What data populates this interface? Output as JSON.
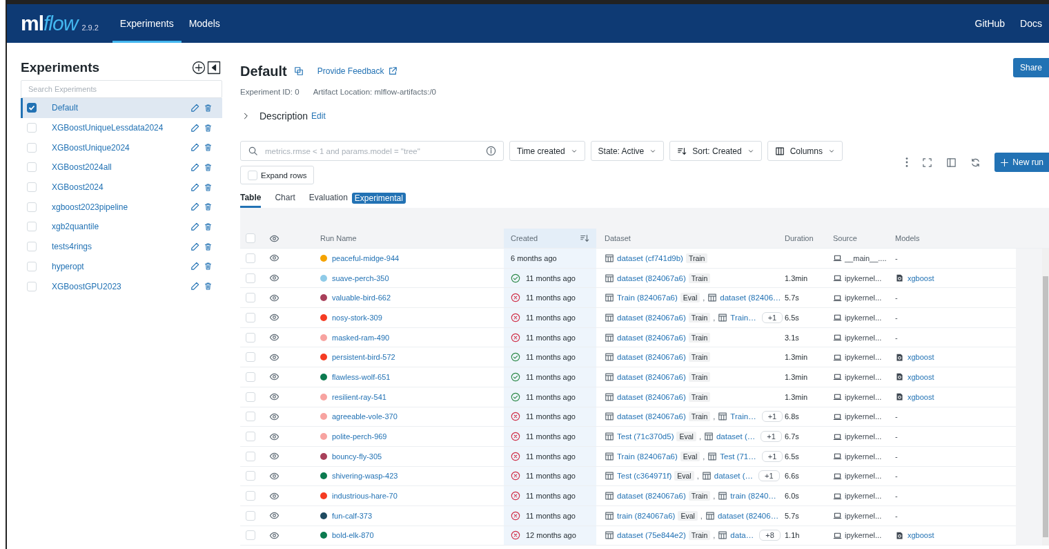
{
  "nav": {
    "logo": {
      "left": "ml",
      "right": "flow"
    },
    "version": "2.9.2",
    "tabs": [
      {
        "label": "Experiments",
        "selected": true
      },
      {
        "label": "Models",
        "selected": false
      }
    ],
    "links": [
      "GitHub",
      "Docs"
    ]
  },
  "sidebar": {
    "title": "Experiments",
    "search": {
      "placeholder": "Search Experiments"
    },
    "items": [
      {
        "name": "Default",
        "selected": true
      },
      {
        "name": "XGBoostUniqueLessdata2024",
        "selected": false
      },
      {
        "name": "XGBoostUnique2024",
        "selected": false
      },
      {
        "name": "XGBoost2024all",
        "selected": false
      },
      {
        "name": "XGBoost2024",
        "selected": false
      },
      {
        "name": "xgboost2023pipeline",
        "selected": false
      },
      {
        "name": "xgb2quantile",
        "selected": false
      },
      {
        "name": "tests4rings",
        "selected": false
      },
      {
        "name": "hyperopt",
        "selected": false
      },
      {
        "name": "XGBoostGPU2023",
        "selected": false
      }
    ]
  },
  "header": {
    "title": "Default",
    "feedback": "Provide Feedback",
    "share": "Share",
    "experiment_id": "Experiment ID: 0",
    "artifact_location": "Artifact Location: mlflow-artifacts:/0",
    "description": "Description",
    "edit": "Edit"
  },
  "toolbar": {
    "search": {
      "placeholder": "metrics.rmse < 1 and params.model = \"tree\""
    },
    "filters": [
      {
        "label": "Time created",
        "kind": "dropdown"
      },
      {
        "label": "State: Active",
        "kind": "dropdown"
      },
      {
        "label": "Sort: Created",
        "kind": "sort"
      },
      {
        "label": "Columns",
        "kind": "columns"
      }
    ],
    "expand_rows": {
      "label": "Expand rows",
      "checked": false
    },
    "new_run": "New run"
  },
  "view_tabs": [
    {
      "label": "Table",
      "selected": true
    },
    {
      "label": "Chart",
      "selected": false
    },
    {
      "label": "Evaluation",
      "selected": false
    }
  ],
  "experimental_badge": "Experimental",
  "table": {
    "select_all": {
      "checked": false
    },
    "columns": [
      "Run Name",
      "Created",
      "Dataset",
      "Duration",
      "Source",
      "Models"
    ],
    "rows": [
      {
        "checked": false,
        "name": "peaceful-midge-944",
        "color": "#f5a300",
        "created": "6 months ago",
        "datasets": [
          {
            "name": "dataset (cf741d9b)",
            "tag": "Train"
          }
        ],
        "source": "__main__....",
        "model": "-",
        "logged_model": false
      },
      {
        "checked": false,
        "name": "suave-perch-350",
        "color": "#8fcbe8",
        "finished": true,
        "created": "11 months ago",
        "datasets": [
          {
            "name": "dataset (824067a6)",
            "tag": "Train"
          }
        ],
        "duration": "1.3min",
        "source": "ipykernel...",
        "model": "xgboost",
        "logged_model": true
      },
      {
        "checked": false,
        "name": "valuable-bird-662",
        "color": "#a8405a",
        "finished": false,
        "created": "11 months ago",
        "datasets": [
          {
            "name": "Train (824067a6)",
            "tag": "Eval"
          },
          {
            "name": "dataset (82406…",
            "separator": ","
          }
        ],
        "duration": "5.7s",
        "source": "ipykernel...",
        "model": "-",
        "logged_model": false
      },
      {
        "checked": false,
        "name": "nosy-stork-309",
        "color": "#f53b22",
        "finished": false,
        "created": "11 months ago",
        "datasets": [
          {
            "name": "dataset (824067a6)",
            "tag": "Train"
          },
          {
            "name": "Train…",
            "separator": ","
          }
        ],
        "more": "+1",
        "duration": "6.5s",
        "source": "ipykernel...",
        "model": "-",
        "logged_model": false
      },
      {
        "checked": false,
        "name": "masked-ram-490",
        "color": "#f7a3a0",
        "finished": false,
        "created": "11 months ago",
        "datasets": [
          {
            "name": "dataset (824067a6)",
            "tag": "Train"
          }
        ],
        "duration": "3.1s",
        "source": "ipykernel...",
        "model": "-",
        "logged_model": false
      },
      {
        "checked": false,
        "name": "persistent-bird-572",
        "color": "#f53b22",
        "finished": true,
        "created": "11 months ago",
        "datasets": [
          {
            "name": "dataset (824067a6)",
            "tag": "Train"
          }
        ],
        "duration": "1.3min",
        "source": "ipykernel...",
        "model": "xgboost",
        "logged_model": true
      },
      {
        "checked": false,
        "name": "flawless-wolf-651",
        "color": "#0b7a4f",
        "finished": true,
        "created": "11 months ago",
        "datasets": [
          {
            "name": "dataset (824067a6)",
            "tag": "Train"
          }
        ],
        "duration": "1.3min",
        "source": "ipykernel...",
        "model": "xgboost",
        "logged_model": true
      },
      {
        "checked": false,
        "name": "resilient-ray-541",
        "color": "#f7a3a0",
        "finished": true,
        "created": "11 months ago",
        "datasets": [
          {
            "name": "dataset (824067a6)",
            "tag": "Train"
          }
        ],
        "duration": "1.3min",
        "source": "ipykernel...",
        "model": "xgboost",
        "logged_model": true
      },
      {
        "checked": false,
        "name": "agreeable-vole-370",
        "color": "#f7a3a0",
        "finished": false,
        "created": "11 months ago",
        "datasets": [
          {
            "name": "dataset (824067a6)",
            "tag": "Train"
          },
          {
            "name": "Train…",
            "separator": ","
          }
        ],
        "more": "+1",
        "duration": "6.8s",
        "source": "ipykernel...",
        "model": "-",
        "logged_model": false
      },
      {
        "checked": false,
        "name": "polite-perch-969",
        "color": "#f7a3a0",
        "finished": false,
        "created": "11 months ago",
        "datasets": [
          {
            "name": "Test (71c370d5)",
            "tag": "Eval"
          },
          {
            "name": "dataset (…",
            "separator": ","
          }
        ],
        "more": "+1",
        "duration": "6.7s",
        "source": "ipykernel...",
        "model": "-",
        "logged_model": false
      },
      {
        "checked": false,
        "name": "bouncy-fly-305",
        "color": "#a8405a",
        "finished": false,
        "created": "11 months ago",
        "datasets": [
          {
            "name": "Train (824067a6)",
            "tag": "Eval"
          },
          {
            "name": "Test (71…",
            "separator": ","
          }
        ],
        "more": "+1",
        "duration": "6.5s",
        "source": "ipykernel...",
        "model": "-",
        "logged_model": false
      },
      {
        "checked": false,
        "name": "shivering-wasp-423",
        "color": "#0b7a4f",
        "finished": false,
        "created": "11 months ago",
        "datasets": [
          {
            "name": "Test (c364971f)",
            "tag": "Eval"
          },
          {
            "name": "dataset (…",
            "separator": ","
          }
        ],
        "more": "+1",
        "duration": "6.6s",
        "source": "ipykernel...",
        "model": "-",
        "logged_model": false
      },
      {
        "checked": false,
        "name": "industrious-hare-70",
        "color": "#f53b22",
        "finished": false,
        "created": "11 months ago",
        "datasets": [
          {
            "name": "dataset (824067a6)",
            "tag": "Train"
          },
          {
            "name": "train (8240…",
            "separator": ","
          }
        ],
        "duration": "6.0s",
        "source": "ipykernel...",
        "model": "-",
        "logged_model": false
      },
      {
        "checked": false,
        "name": "fun-calf-373",
        "color": "#1e4a60",
        "finished": false,
        "created": "11 months ago",
        "datasets": [
          {
            "name": "train (824067a6)",
            "tag": "Eval"
          },
          {
            "name": "dataset (82406…",
            "separator": ","
          }
        ],
        "duration": "5.7s",
        "source": "ipykernel...",
        "model": "-",
        "logged_model": false
      },
      {
        "checked": false,
        "name": "bold-elk-870",
        "color": "#0b7a4f",
        "finished": false,
        "created": "12 months ago",
        "datasets": [
          {
            "name": "dataset (75e844e2)",
            "tag": "Train"
          },
          {
            "name": "data…",
            "separator": ","
          }
        ],
        "more": "+8",
        "duration": "1.1h",
        "source": "ipykernel...",
        "model": "xgboost",
        "logged_model": true
      }
    ]
  }
}
